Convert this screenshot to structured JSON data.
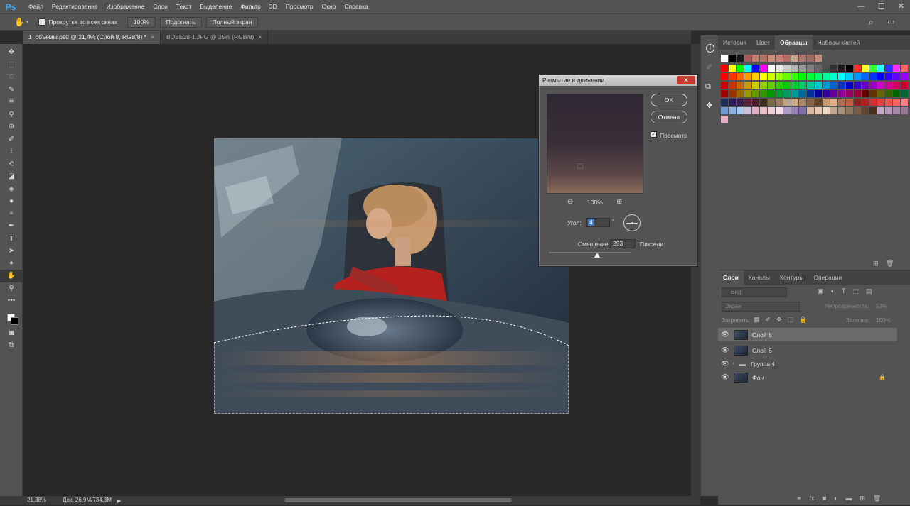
{
  "app": {
    "logo": "Ps"
  },
  "menu": [
    "Файл",
    "Редактирование",
    "Изображение",
    "Слои",
    "Текст",
    "Выделение",
    "Фильтр",
    "3D",
    "Просмотр",
    "Окно",
    "Справка"
  ],
  "window_controls": {
    "minimize": "—",
    "maximize": "☐",
    "close": "✕"
  },
  "options": {
    "scroll_all_label": "Прокрутка во всех окнах",
    "zoom_btn": "100%",
    "fit_btn": "Подогнать",
    "fullscreen_btn": "Полный экран"
  },
  "tabs": [
    {
      "label": "1_объемы.psd @ 21,4% (Слой 8, RGB/8) *",
      "close": "×"
    },
    {
      "label": "BOBE28-1.JPG @ 25% (RGB/8)",
      "close": "×"
    }
  ],
  "status": {
    "zoom": "21,38%",
    "doc": "Док: 26,9M/734,3M"
  },
  "panel_top": {
    "tabs": [
      "История",
      "Цвет",
      "Образцы",
      "Наборы кистей"
    ],
    "active": "Образцы"
  },
  "dialog": {
    "title": "Размытие в движении",
    "ok": "OK",
    "cancel": "Отмена",
    "preview_label": "Просмотр",
    "zoom": "100%",
    "angle_label": "Угол:",
    "angle_value": "4",
    "angle_unit": "°",
    "distance_label": "Смещение:",
    "distance_value": "253",
    "distance_unit": "Пиксели"
  },
  "layers_panel": {
    "tabs": [
      "Слои",
      "Каналы",
      "Контуры",
      "Операции"
    ],
    "filter_placeholder": "Вид",
    "blend_mode": "Экран",
    "opacity_label": "Непрозрачность:",
    "opacity_value": "53%",
    "lock_label": "Закрепить:",
    "fill_label": "Заливка:",
    "fill_value": "100%",
    "layers": [
      {
        "name": "Слой 8",
        "selected": true
      },
      {
        "name": "Слой 6",
        "selected": false
      },
      {
        "name": "Группа 4",
        "selected": false,
        "group": true
      },
      {
        "name": "Фон",
        "selected": false,
        "locked": true
      }
    ]
  },
  "colors": {
    "accent": "#31a8ff",
    "close_red": "#c9382c"
  }
}
